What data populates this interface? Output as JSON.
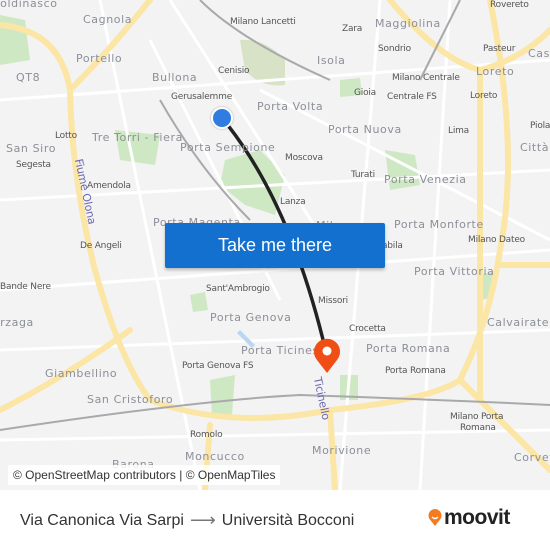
{
  "map": {
    "labels": [
      "Boldinasco",
      "Cagnola",
      "Portello",
      "QT8",
      "Bullona",
      "Cenisio",
      "Milano Lancetti",
      "Gerusalemme",
      "Porta Volta",
      "Lotto",
      "Tre Torri - Fiera",
      "San Siro",
      "Porta Sempione",
      "Segesta",
      "Amendola",
      "Porta Magenta",
      "Zara",
      "Maggiolina",
      "Sondrio",
      "Isola",
      "Milano Centrale",
      "Gioia",
      "Centrale FS",
      "Loreto",
      "Loreto",
      "Rovereto",
      "Pasteur",
      "Caso",
      "Porta Nuova",
      "Lima",
      "Piola",
      "Città",
      "Moscova",
      "Turati",
      "Porta Venezia",
      "Lanza",
      "Milano",
      "Porta Monforte",
      "Milano Dateo",
      "Babila",
      "De Angeli",
      "Porta Vittoria",
      "Bande Nere",
      "Sant'Ambrogio",
      "Arzaga",
      "Missori",
      "Porta Genova",
      "Calvairate",
      "Crocetta",
      "Porta Ticinese",
      "Porta Romana",
      "Porta Romana",
      "Giambellino",
      "Porta Genova FS",
      "San Cristoforo",
      "Milano Porta",
      "Romana",
      "Romolo",
      "Morivione",
      "Moncucco",
      "Corvet",
      "Barona"
    ],
    "waterways": [
      "Fiume Olona",
      "Ticinello"
    ],
    "origin_marker": {
      "icon": "origin-dot-icon",
      "color": "#2f7de1"
    },
    "destination_marker": {
      "icon": "map-pin-icon",
      "color": "#f04e14"
    },
    "route_color": "#222222"
  },
  "cta": {
    "label": "Take me there",
    "color": "#1470cf"
  },
  "attribution": "© OpenStreetMap contributors | © OpenMapTiles",
  "footer": {
    "origin": "Via Canonica Via Sarpi",
    "arrow_icon": "arrow-right-icon",
    "destination": "Università Bocconi",
    "brand": "moovit",
    "brand_color": "#f47c20"
  }
}
